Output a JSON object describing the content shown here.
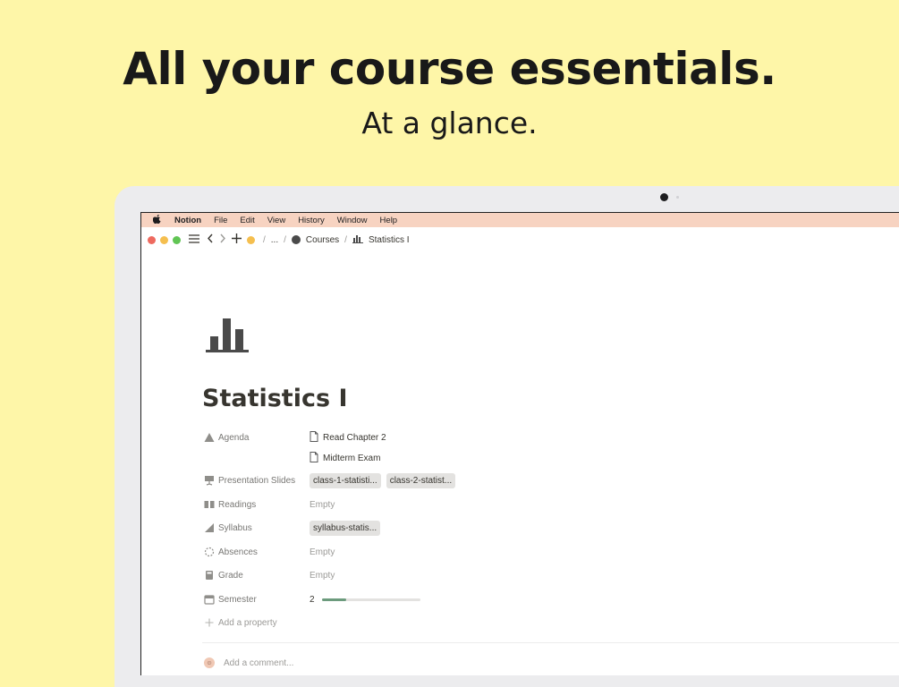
{
  "hero": {
    "headline": "All your course essentials.",
    "subline": "At a glance."
  },
  "menubar": {
    "app_name": "Notion",
    "items": [
      "File",
      "Edit",
      "View",
      "History",
      "Window",
      "Help"
    ]
  },
  "titlebar": {
    "traffic_lights": {
      "close": "#ee6a5f",
      "minimize": "#f5bf4f",
      "zoom": "#61c554"
    },
    "breadcrumb": {
      "ellipsis": "...",
      "parent": "Courses",
      "current": "Statistics I"
    }
  },
  "page": {
    "icon": "bar-chart-icon",
    "title": "Statistics I",
    "properties": {
      "agenda": {
        "label": "Agenda",
        "items": [
          "Read Chapter 2",
          "Midterm Exam"
        ]
      },
      "slides": {
        "label": "Presentation Slides",
        "files": [
          "class-1-statisti...",
          "class-2-statist..."
        ]
      },
      "readings": {
        "label": "Readings",
        "value": "Empty"
      },
      "syllabus": {
        "label": "Syllabus",
        "files": [
          "syllabus-statis..."
        ]
      },
      "absences": {
        "label": "Absences",
        "value": "Empty"
      },
      "grade": {
        "label": "Grade",
        "value": "Empty"
      },
      "semester": {
        "label": "Semester",
        "value": "2",
        "progress": 0.25
      }
    },
    "add_property": "Add a property",
    "comment_placeholder": "Add a comment..."
  },
  "colors": {
    "background": "#fef6a8",
    "menubar": "#f7d3c1",
    "progress": "#6c9b7d"
  }
}
